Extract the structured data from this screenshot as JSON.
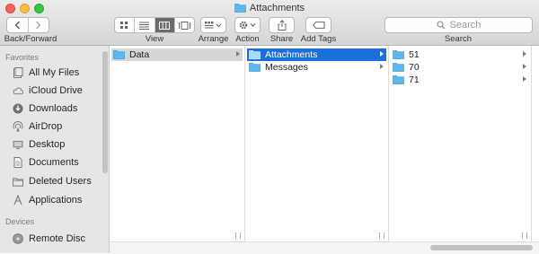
{
  "window": {
    "title": "Attachments"
  },
  "toolbar": {
    "back_forward_label": "Back/Forward",
    "view_label": "View",
    "arrange_label": "Arrange",
    "action_label": "Action",
    "share_label": "Share",
    "add_tags_label": "Add Tags",
    "search_label": "Search",
    "search_placeholder": "Search",
    "active_view": "columns"
  },
  "sidebar": {
    "favorites_header": "Favorites",
    "devices_header": "Devices",
    "favorites": [
      {
        "label": "All My Files",
        "icon": "all-files-icon"
      },
      {
        "label": "iCloud Drive",
        "icon": "cloud-icon"
      },
      {
        "label": "Downloads",
        "icon": "download-icon"
      },
      {
        "label": "AirDrop",
        "icon": "airdrop-icon"
      },
      {
        "label": "Desktop",
        "icon": "desktop-icon"
      },
      {
        "label": "Documents",
        "icon": "documents-icon"
      },
      {
        "label": "Deleted Users",
        "icon": "folder-icon"
      },
      {
        "label": "Applications",
        "icon": "applications-icon"
      }
    ],
    "devices": [
      {
        "label": "Remote Disc",
        "icon": "disc-icon"
      }
    ]
  },
  "columns": [
    {
      "items": [
        {
          "label": "Data",
          "selected": "inactive",
          "has_children": true
        }
      ]
    },
    {
      "items": [
        {
          "label": "Attachments",
          "selected": "active",
          "has_children": true
        },
        {
          "label": "Messages",
          "selected": "none",
          "has_children": true
        }
      ]
    },
    {
      "items": [
        {
          "label": "51",
          "selected": "none",
          "has_children": true
        },
        {
          "label": "70",
          "selected": "none",
          "has_children": true
        },
        {
          "label": "71",
          "selected": "none",
          "has_children": true
        }
      ]
    }
  ],
  "colors": {
    "selection_blue": "#1c6fd9",
    "folder_blue": "#5ab8ee",
    "selection_gray": "#d6d6d6"
  }
}
